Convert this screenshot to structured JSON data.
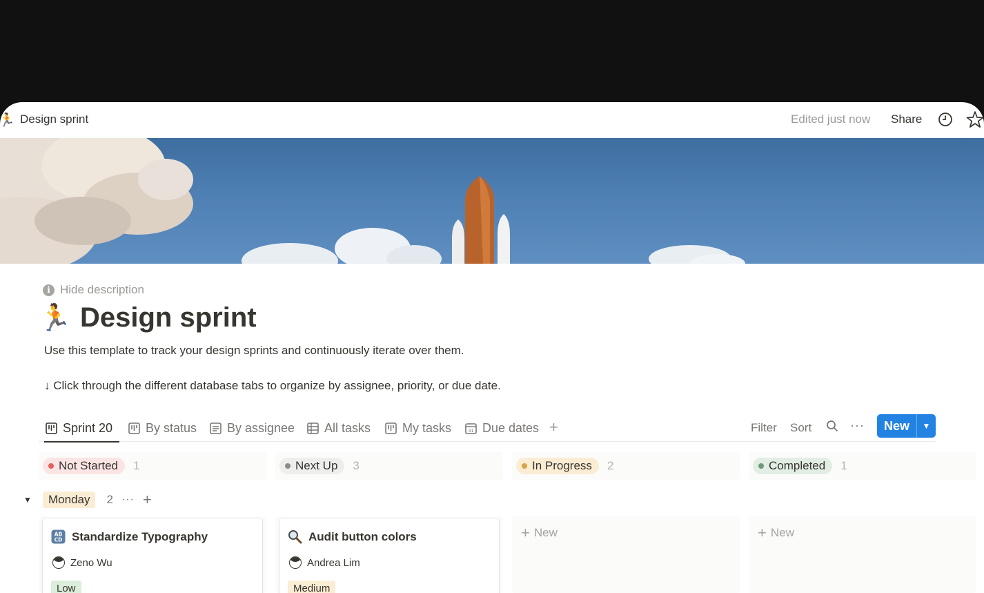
{
  "topbar": {
    "page_emoji": "🏃",
    "breadcrumb": "Design sprint",
    "edited": "Edited just now",
    "share": "Share"
  },
  "description": {
    "hide_label": "Hide description",
    "title_emoji": "🏃",
    "title": "Design sprint",
    "line1": "Use this template to track your design sprints and continuously iterate over them.",
    "line2": "↓ Click through the different database tabs to organize by assignee, priority, or due date."
  },
  "views": {
    "tabs": [
      {
        "label": "Sprint 20",
        "icon": "board-icon"
      },
      {
        "label": "By status",
        "icon": "board-icon"
      },
      {
        "label": "By assignee",
        "icon": "list-icon"
      },
      {
        "label": "All tasks",
        "icon": "table-icon"
      },
      {
        "label": "My tasks",
        "icon": "board-icon"
      },
      {
        "label": "Due dates",
        "icon": "calendar-icon"
      }
    ],
    "active": "Sprint 20",
    "filter": "Filter",
    "sort": "Sort",
    "more": "···",
    "new_label": "New",
    "accent": "#2383e2"
  },
  "board": {
    "columns": [
      {
        "label": "Not Started",
        "count": "1",
        "bg": "#fbe4e4",
        "dot": "#e16259"
      },
      {
        "label": "Next Up",
        "count": "3",
        "bg": "#eeeeec",
        "dot": "#8c8b88"
      },
      {
        "label": "In Progress",
        "count": "2",
        "bg": "#fbecd4",
        "dot": "#d9a44a"
      },
      {
        "label": "Completed",
        "count": "1",
        "bg": "#e2eee4",
        "dot": "#6c9b7d"
      }
    ],
    "group": {
      "label": "Monday",
      "count": "2"
    },
    "cards": [
      {
        "icon": "🔤",
        "title": "Standardize Typography",
        "assignee": "Zeno Wu",
        "priority": "Low",
        "priority_bg": "#dbeddb"
      },
      {
        "icon": "🔍",
        "title": "Audit button colors",
        "assignee": "Andrea Lim",
        "priority": "Medium",
        "priority_bg": "#fbecd4"
      }
    ],
    "new_label": "New"
  }
}
